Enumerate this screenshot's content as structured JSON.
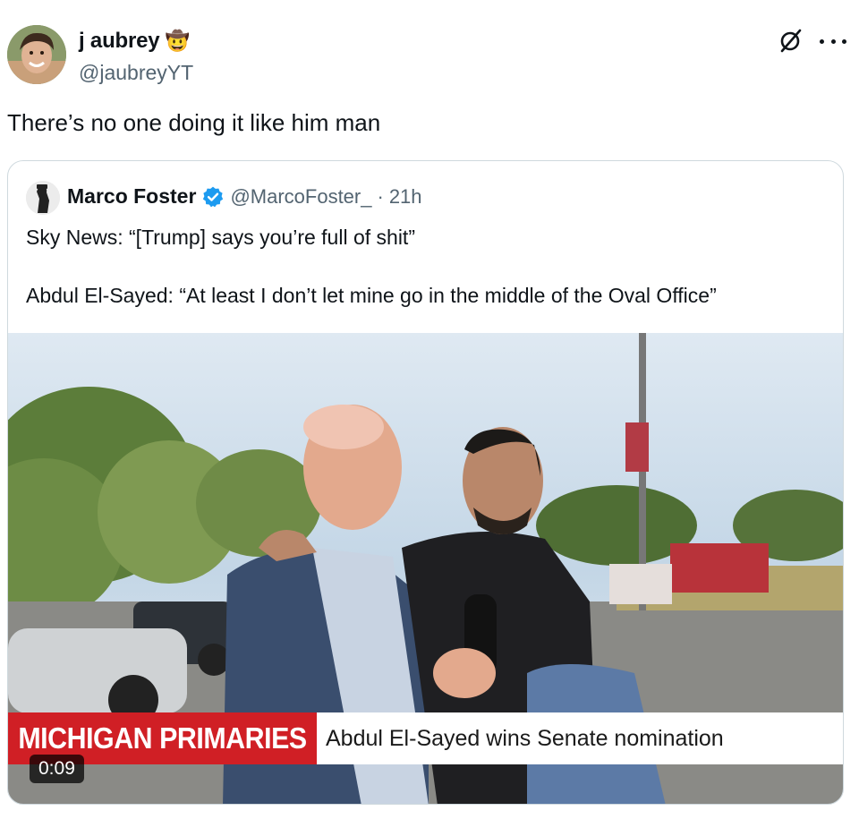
{
  "tweet": {
    "author": {
      "display_name": "j aubrey",
      "name_emoji": "🤠",
      "handle": "@jaubreyYT"
    },
    "text": "There’s no one doing it like him man",
    "icons": [
      "grok-icon",
      "more-icon"
    ]
  },
  "quoted_tweet": {
    "author": {
      "display_name": "Marco Foster",
      "verified": true,
      "handle": "@MarcoFoster_",
      "separator": "·",
      "time": "21h"
    },
    "line1": "Sky News: “[Trump] says you’re full of shit”",
    "line2": "Abdul El-Sayed: “At least I don’t let mine go in the middle of the Oval Office”",
    "video": {
      "banner_red": "MICHIGAN PRIMARIES",
      "banner_white": "Abdul El-Sayed wins Senate nomination",
      "duration": "0:09"
    }
  },
  "colors": {
    "verified": "#1d9bf0",
    "banner_red": "#d01f25",
    "secondary_text": "#536471",
    "border": "#cfd9de"
  }
}
